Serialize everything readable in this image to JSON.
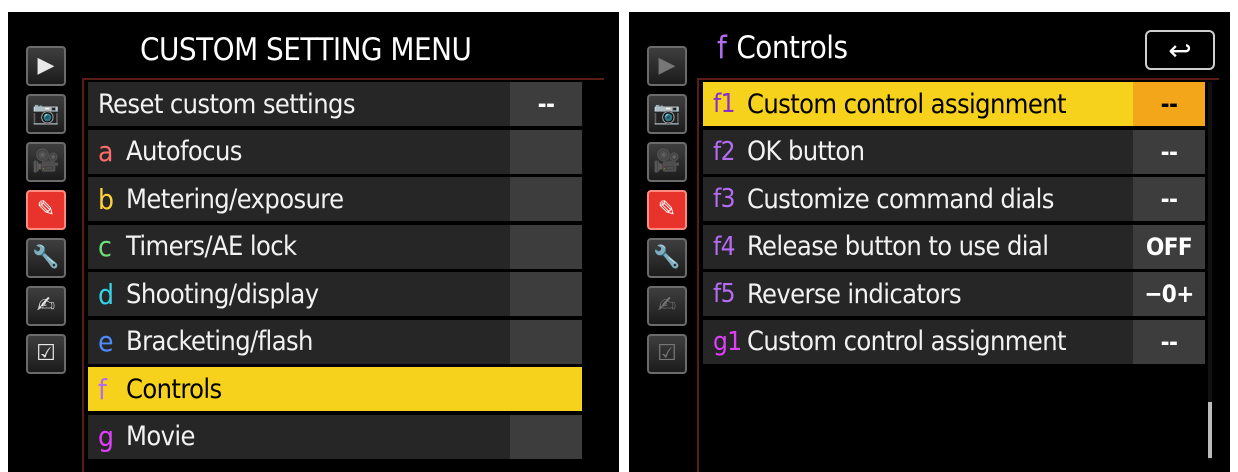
{
  "left": {
    "title": "CUSTOM SETTING MENU",
    "tabs": [
      {
        "icon": "playback-icon",
        "glyph": "▶"
      },
      {
        "icon": "camera-icon",
        "glyph": "📷"
      },
      {
        "icon": "movie-camera-icon",
        "glyph": "🎥"
      },
      {
        "icon": "pencil-icon",
        "glyph": "✎"
      },
      {
        "icon": "wrench-icon",
        "glyph": "🔧"
      },
      {
        "icon": "retouch-icon",
        "glyph": "✍"
      },
      {
        "icon": "my-menu-icon",
        "glyph": "☑"
      }
    ],
    "items": [
      {
        "letter": "",
        "label": "Reset custom settings",
        "value": "--",
        "color": ""
      },
      {
        "letter": "a",
        "label": "Autofocus",
        "value": "",
        "color": "#ff6b6b"
      },
      {
        "letter": "b",
        "label": "Metering/exposure",
        "value": "",
        "color": "#ffd23a"
      },
      {
        "letter": "c",
        "label": "Timers/AE lock",
        "value": "",
        "color": "#6ee07a"
      },
      {
        "letter": "d",
        "label": "Shooting/display",
        "value": "",
        "color": "#36d3e8"
      },
      {
        "letter": "e",
        "label": "Bracketing/flash",
        "value": "",
        "color": "#4d8bff"
      },
      {
        "letter": "f",
        "label": "Controls",
        "value": "",
        "color": "#b46cf3"
      },
      {
        "letter": "g",
        "label": "Movie",
        "value": "",
        "color": "#e040fb"
      }
    ]
  },
  "right": {
    "title_letter": "f",
    "title": "Controls",
    "back_icon": "↩",
    "items": [
      {
        "code": "f1",
        "label": "Custom control assignment",
        "value": "--"
      },
      {
        "code": "f2",
        "label": "OK button",
        "value": "--"
      },
      {
        "code": "f3",
        "label": "Customize command dials",
        "value": "--"
      },
      {
        "code": "f4",
        "label": "Release button to use dial",
        "value": "OFF"
      },
      {
        "code": "f5",
        "label": "Reverse indicators",
        "value": "−0+"
      },
      {
        "code": "g1",
        "label": "Custom control assignment",
        "value": "--"
      }
    ]
  },
  "colors": {
    "selected_bg": "#f7d21c",
    "selected_value_bg": "#f3a619",
    "active_tab": "#e8332d",
    "controls_purple": "#b46cf3",
    "movie_magenta": "#e040fb"
  }
}
